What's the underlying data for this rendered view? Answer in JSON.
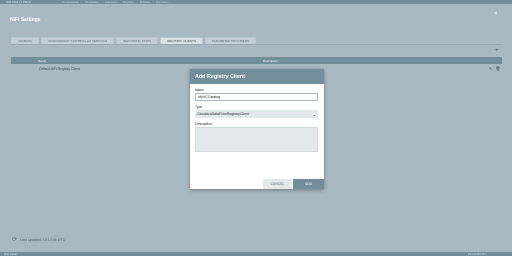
{
  "topbar": {
    "brand": "NiFi Flow (1 PM-3)",
    "items": [
      "Components",
      "Templates",
      "Counters",
      "Registry",
      "Bulletin",
      "Summary"
    ]
  },
  "settings": {
    "title": "NiFi Settings",
    "close_label": "×",
    "tabs": [
      {
        "label": "GENERAL"
      },
      {
        "label": "MANAGEMENT CONTROLLER SERVICES"
      },
      {
        "label": "REPORTING TASKS"
      },
      {
        "label": "REGISTRY CLIENTS"
      },
      {
        "label": "PARAMETER PROVIDERS"
      }
    ],
    "add_label": "+"
  },
  "table": {
    "columns": {
      "name": "Name",
      "description": "Description"
    },
    "rows": [
      {
        "name": "Default NiFi Registry Client"
      }
    ]
  },
  "last_updated": "Last updated: 10:13:36 UTC",
  "bottombar": {
    "left": "NiFi Flow",
    "right": "10:13:36 UTC"
  },
  "dialog": {
    "title": "Add Registry Client",
    "name_label": "Name",
    "name_value": "MyVCCatalog",
    "type_label": "Type",
    "type_value": "ClouderaDataFlowRegistryClient",
    "description_label": "Description",
    "description_value": "",
    "cancel_label": "CANCEL",
    "add_label": "ADD"
  }
}
